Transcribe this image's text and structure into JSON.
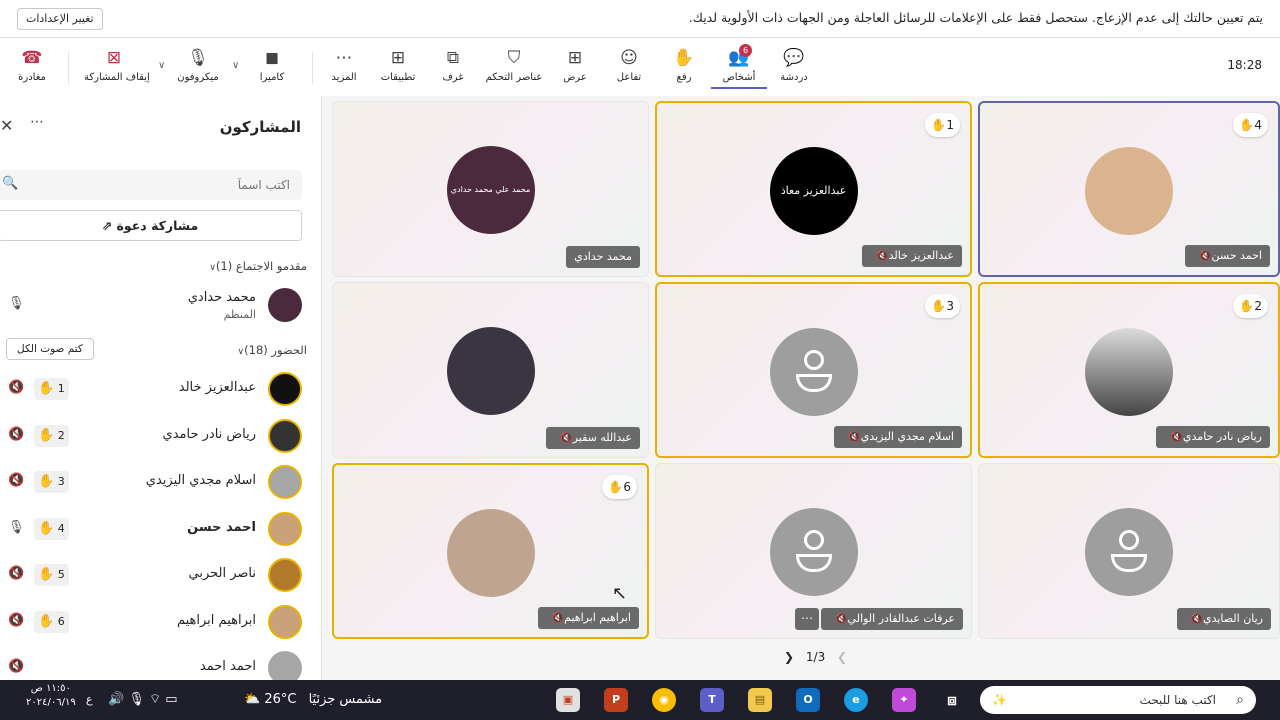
{
  "notification": {
    "button": "تغيير الإعدادات",
    "text": "يتم تعيين حالتك إلى عدم الإزعاج. ستحصل فقط على الإعلامات للرسائل العاجلة ومن الجهات ذات الأولوية لديك."
  },
  "toolbar": {
    "time": "18:28",
    "leave": "مغادرة",
    "stop_share": "إيقاف المشاركة",
    "mic": "ميكروفون",
    "camera": "كاميرا",
    "more": "المزيد",
    "apps": "تطبيقات",
    "rooms": "غرف",
    "controls": "عناصر التحكم",
    "view": "عرض",
    "react": "تفاعل",
    "raise": "رفع",
    "people": "أشخاص",
    "people_badge": "6",
    "chat": "دردشة"
  },
  "sidebar": {
    "title": "المشاركون",
    "search_placeholder": "اكتب اسماً",
    "invite": "مشاركة دعوة",
    "presenters_header": "مقدمو الاجتماع (1)",
    "attendees_header": "الحضور (18)",
    "mute_all": "كتم صوت الكل",
    "organizer": {
      "name": "محمد حدادي",
      "role": "المنظم"
    },
    "attendees": [
      {
        "name": "عبدالعزيز خالد",
        "hand": "1"
      },
      {
        "name": "رياض نادر حامدي",
        "hand": "2"
      },
      {
        "name": "اسلام مجدي اليزيدي",
        "hand": "3"
      },
      {
        "name": "احمد حسن",
        "hand": "4"
      },
      {
        "name": "ناصر الحربي",
        "hand": "5"
      },
      {
        "name": "ابراهيم ابراهيم",
        "hand": "6"
      },
      {
        "name": "احمد احمد",
        "hand": ""
      }
    ]
  },
  "tiles": [
    {
      "name": "محمد حدادي",
      "hand": "",
      "avatar_text": "محمد علي محمد حدادي"
    },
    {
      "name": "عبدالعزيز خالد",
      "hand": "1",
      "avatar_text": "عبدالعزيز معاذ"
    },
    {
      "name": "احمد حسن",
      "hand": "4"
    },
    {
      "name": "عبدالله سقير",
      "hand": ""
    },
    {
      "name": "اسلام مجدي اليزيدي",
      "hand": "3"
    },
    {
      "name": "رياض نادر حامدي",
      "hand": "2"
    },
    {
      "name": "ابراهيم ابراهيم",
      "hand": "6"
    },
    {
      "name": "عرفات عبدالقادر الوالي",
      "hand": ""
    },
    {
      "name": "ريان الصايدي",
      "hand": ""
    }
  ],
  "pager": "1/3",
  "taskbar": {
    "search": "اكتب هنا للبحث",
    "weather_temp": "26°C",
    "weather_text": "مشمس جزئيًا",
    "time": "١١:٥٠ ص",
    "date": "٢٠٢٤/٠٦/١٩",
    "lang": "ع",
    "teams_badge": "1"
  }
}
